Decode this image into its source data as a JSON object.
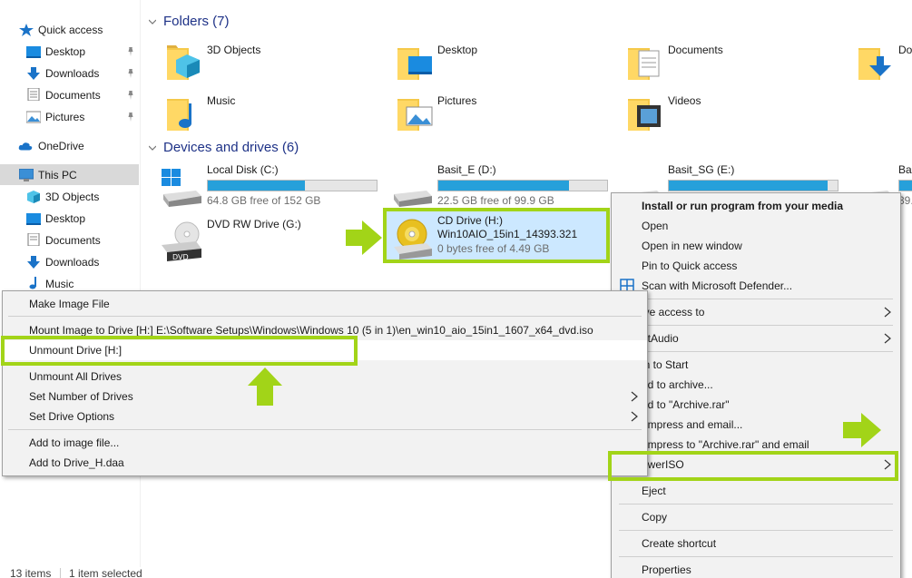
{
  "sidebar": {
    "quick_access": "Quick access",
    "qa_items": [
      "Desktop",
      "Downloads",
      "Documents",
      "Pictures"
    ],
    "onedrive": "OneDrive",
    "this_pc": "This PC",
    "pc_items": [
      "3D Objects",
      "Desktop",
      "Documents",
      "Downloads",
      "Music"
    ]
  },
  "folders": {
    "header": "Folders (7)",
    "items": [
      "3D Objects",
      "Desktop",
      "Documents",
      "Do",
      "Music",
      "Pictures",
      "Videos"
    ]
  },
  "devices": {
    "header": "Devices and drives (6)",
    "drives": [
      {
        "name": "Local Disk (C:)",
        "free": "64.8 GB free of 152 GB",
        "used_fraction": 0.574
      },
      {
        "name": "Basit_E (D:)",
        "free": "22.5 GB free of 99.9 GB",
        "used_fraction": 0.775
      },
      {
        "name": "Basit_SG (E:)",
        "free": "",
        "used_fraction": 0.94
      },
      {
        "name": "Bas",
        "free": "39.",
        "used_fraction": 0.6
      },
      {
        "name": "DVD RW Drive (G:)",
        "free": ""
      },
      {
        "name": "CD Drive (H:)",
        "label": "Win10AIO_15in1_14393.321",
        "free": "0 bytes free of 4.49 GB"
      }
    ]
  },
  "context_menu": {
    "items": [
      "Install or run program from your media",
      "Open",
      "Open in new window",
      "Pin to Quick access",
      "Scan with Microsoft Defender...",
      "ive access to",
      "etAudio",
      "in to Start",
      "dd to archive...",
      "dd to \"Archive.rar\"",
      "ompress and email...",
      "ompress to \"Archive.rar\" and email",
      "owerISO",
      "Eject",
      "Copy",
      "Create shortcut",
      "Properties"
    ]
  },
  "poweriso_menu": {
    "items": [
      "Make Image File",
      "Mount Image to Drive [H:] E:\\Software Setups\\Windows\\Windows 10 (5 in 1)\\en_win10_aio_15in1_1607_x64_dvd.iso",
      "Unmount Drive [H:]",
      "Unmount All Drives",
      "Set Number of Drives",
      "Set Drive Options",
      "Add to image file...",
      "Add to Drive_H.daa"
    ]
  },
  "status": {
    "items": "13 items",
    "selected": "1 item selected"
  },
  "colors": {
    "accent_green": "#a2d418",
    "bar_blue": "#26a0da",
    "header_blue": "#1e3287",
    "selection": "#cce8ff"
  }
}
